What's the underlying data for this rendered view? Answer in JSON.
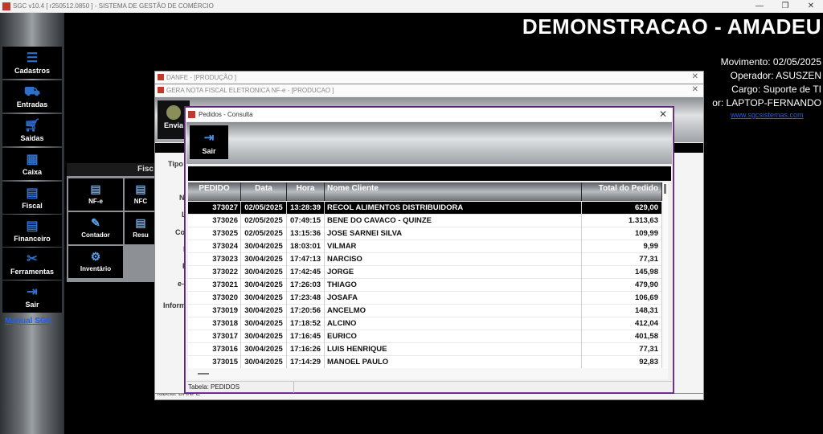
{
  "window": {
    "title": "SGC v10.4 [ r250512.0850 ] - SISTEMA DE GESTÃO DE COMÉRCIO",
    "minimize": "—",
    "maximize": "❐",
    "close": "✕"
  },
  "sidebar": {
    "items": [
      {
        "label": "Cadastros",
        "icon": "cadastros-icon"
      },
      {
        "label": "Entradas",
        "icon": "truck-icon"
      },
      {
        "label": "Saidas",
        "icon": "cart-icon"
      },
      {
        "label": "Caixa",
        "icon": "cash-register-icon"
      },
      {
        "label": "Fiscal",
        "icon": "fiscal-document-icon"
      },
      {
        "label": "Financeiro",
        "icon": "financeiro-document-icon"
      },
      {
        "label": "Ferramentas",
        "icon": "tools-icon"
      },
      {
        "label": "Sair",
        "icon": "exit-door-icon"
      }
    ],
    "manual_link": "Manual SGC"
  },
  "header": {
    "brand": "DEMONSTRACAO - AMADEU",
    "movimento": "Movimento: 02/05/2025",
    "operador": "Operador: ASUSZEN",
    "cargo": "Cargo: Suporte de TI",
    "servidor": "or: LAPTOP-FERNANDO",
    "website": "www.sgcsistemas.com"
  },
  "fiscal_panel": {
    "title": "Fisc",
    "tiles": [
      {
        "label": "NF-e",
        "icon": "nfe-icon"
      },
      {
        "label": "NFC",
        "icon": "nfce-icon"
      },
      {
        "label": "Contador",
        "icon": "contador-icon"
      },
      {
        "label": "Resu",
        "icon": "resumo-icon"
      },
      {
        "label": "Inventário",
        "icon": "inventario-icon"
      }
    ]
  },
  "danfe_window": {
    "title": "DANFE - [PRODUÇÃO   ]",
    "close": "✕",
    "status": "Tabela: DANFE"
  },
  "gera_window": {
    "title": "GERA NOTA FISCAL ELETRONICA NF-e - [PRODUCAO   ]",
    "close": "✕",
    "enviar_label": "Envia",
    "field_labels": [
      "Tipo",
      "N",
      "L",
      "Co",
      "I",
      "F",
      "e-",
      "Inform"
    ]
  },
  "pedidos": {
    "title": "Pedidos - Consulta",
    "close": "✕",
    "sair_label": "Sair",
    "columns": [
      "PEDIDO",
      "Data",
      "Hora",
      "Nome Cliente",
      "Total do Pedido"
    ],
    "rows": [
      [
        "373027",
        "02/05/2025",
        "13:28:39",
        "RECOL ALIMENTOS DISTRIBUIDORA",
        "629,00"
      ],
      [
        "373026",
        "02/05/2025",
        "07:49:15",
        "BENE DO CAVACO - QUINZE",
        "1.313,63"
      ],
      [
        "373025",
        "02/05/2025",
        "13:15:36",
        "JOSE SARNEI SILVA",
        "109,99"
      ],
      [
        "373024",
        "30/04/2025",
        "18:03:01",
        "VILMAR",
        "9,99"
      ],
      [
        "373023",
        "30/04/2025",
        "17:47:13",
        "NARCISO",
        "77,31"
      ],
      [
        "373022",
        "30/04/2025",
        "17:42:45",
        "JORGE",
        "145,98"
      ],
      [
        "373021",
        "30/04/2025",
        "17:26:03",
        "THIAGO",
        "479,90"
      ],
      [
        "373020",
        "30/04/2025",
        "17:23:48",
        "JOSAFA",
        "106,69"
      ],
      [
        "373019",
        "30/04/2025",
        "17:20:56",
        "ANCELMO",
        "148,31"
      ],
      [
        "373018",
        "30/04/2025",
        "17:18:52",
        "ALCINO",
        "412,04"
      ],
      [
        "373017",
        "30/04/2025",
        "17:16:45",
        "EURICO",
        "401,58"
      ],
      [
        "373016",
        "30/04/2025",
        "17:16:26",
        "LUIS HENRIQUE",
        "77,31"
      ],
      [
        "373015",
        "30/04/2025",
        "17:14:29",
        "MANOEL PAULO",
        "92,83"
      ]
    ],
    "selected_row": 0,
    "status": "Tabela: PEDIDOS"
  }
}
